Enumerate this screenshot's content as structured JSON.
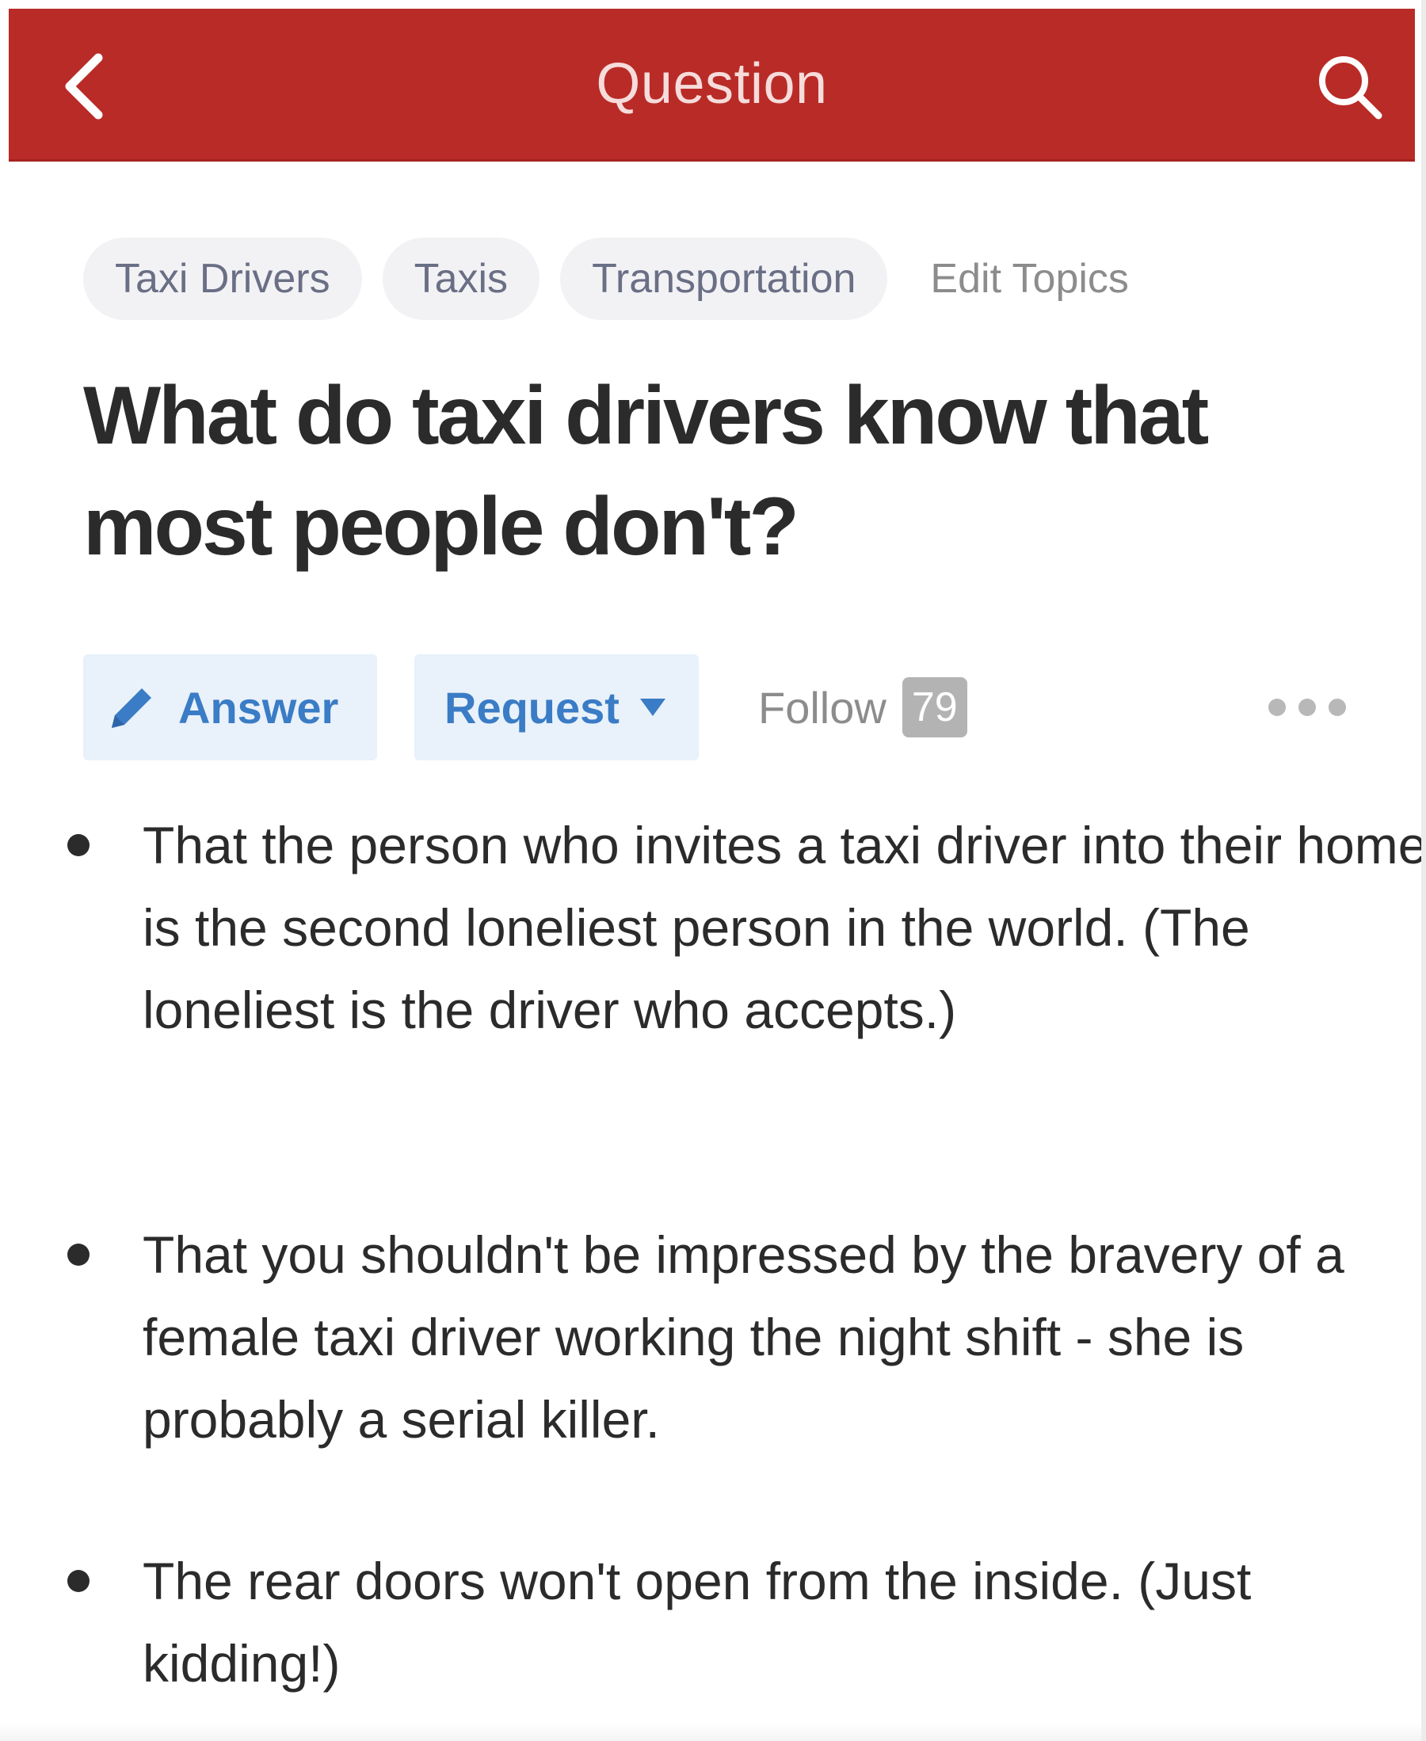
{
  "header": {
    "title": "Question",
    "background_color": "#b92b27",
    "back_icon": "chevron-left-icon",
    "search_icon": "search-icon"
  },
  "topics": {
    "items": [
      {
        "label": "Taxi Drivers"
      },
      {
        "label": "Taxis"
      },
      {
        "label": "Transportation"
      }
    ],
    "edit_label": "Edit Topics"
  },
  "question": {
    "title": "What do taxi drivers know that most people don't?"
  },
  "actions": {
    "answer_label": "Answer",
    "answer_icon": "pencil-icon",
    "request_label": "Request",
    "request_icon": "caret-down-icon",
    "follow_label": "Follow",
    "follow_count": "79",
    "more_icon": "more-dots-icon",
    "accent_color": "#3a7cc5"
  },
  "answer": {
    "bullets": [
      {
        "text": "That the person who invites a taxi driver into their home is the second loneliest person in the world. (The loneliest is the driver who accepts.)"
      },
      {
        "text": "That you shouldn't be impressed by the bravery of a female taxi driver working the night shift - she is probably a serial killer."
      },
      {
        "text": "The rear doors won't open from the inside. (Just kidding!)"
      }
    ]
  }
}
